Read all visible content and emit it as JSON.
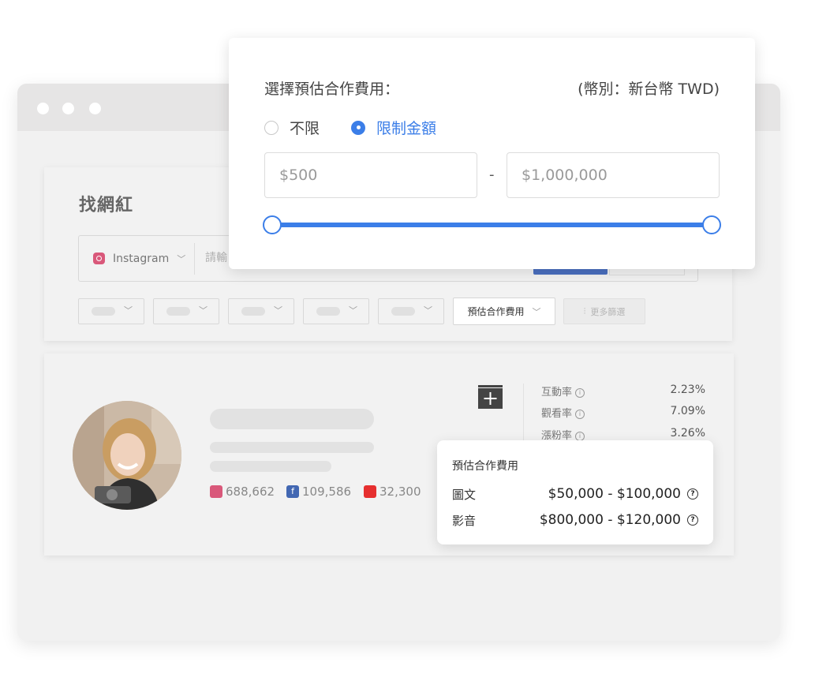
{
  "page": {
    "title": "找網紅"
  },
  "search": {
    "platform": "Instagram",
    "placeholder": "請輸"
  },
  "filters": {
    "active_label": "預估合作費用",
    "more_label": "更多篩選"
  },
  "profile": {
    "stats": {
      "instagram": "688,662",
      "facebook": "109,586",
      "youtube": "32,300"
    },
    "metrics": [
      {
        "label": "互動率",
        "value": "2.23%"
      },
      {
        "label": "觀看率",
        "value": "7.09%"
      },
      {
        "label": "漲粉率",
        "value": "3.26%"
      }
    ]
  },
  "fee_popup": {
    "label": "選擇預估合作費用：",
    "currency": "(幣別：新台幣 TWD)",
    "option_unlimited": "不限",
    "option_limited": "限制金額",
    "selected_option": "限制金額",
    "min_value": "$500",
    "max_value": "$1,000,000",
    "separator": "-",
    "range_fraction": {
      "min": 0,
      "max": 1
    }
  },
  "fee_tooltip": {
    "title": "預估合作費用",
    "rows": [
      {
        "label": "圖文",
        "value": "$50,000 - $100,000"
      },
      {
        "label": "影音",
        "value": "$800,000 - $120,000"
      }
    ],
    "help_symbol": "?"
  },
  "colors": {
    "accent": "#3b7ee8",
    "instagram": "#d9587a",
    "facebook": "#4267b2",
    "youtube": "#e62f2f"
  }
}
